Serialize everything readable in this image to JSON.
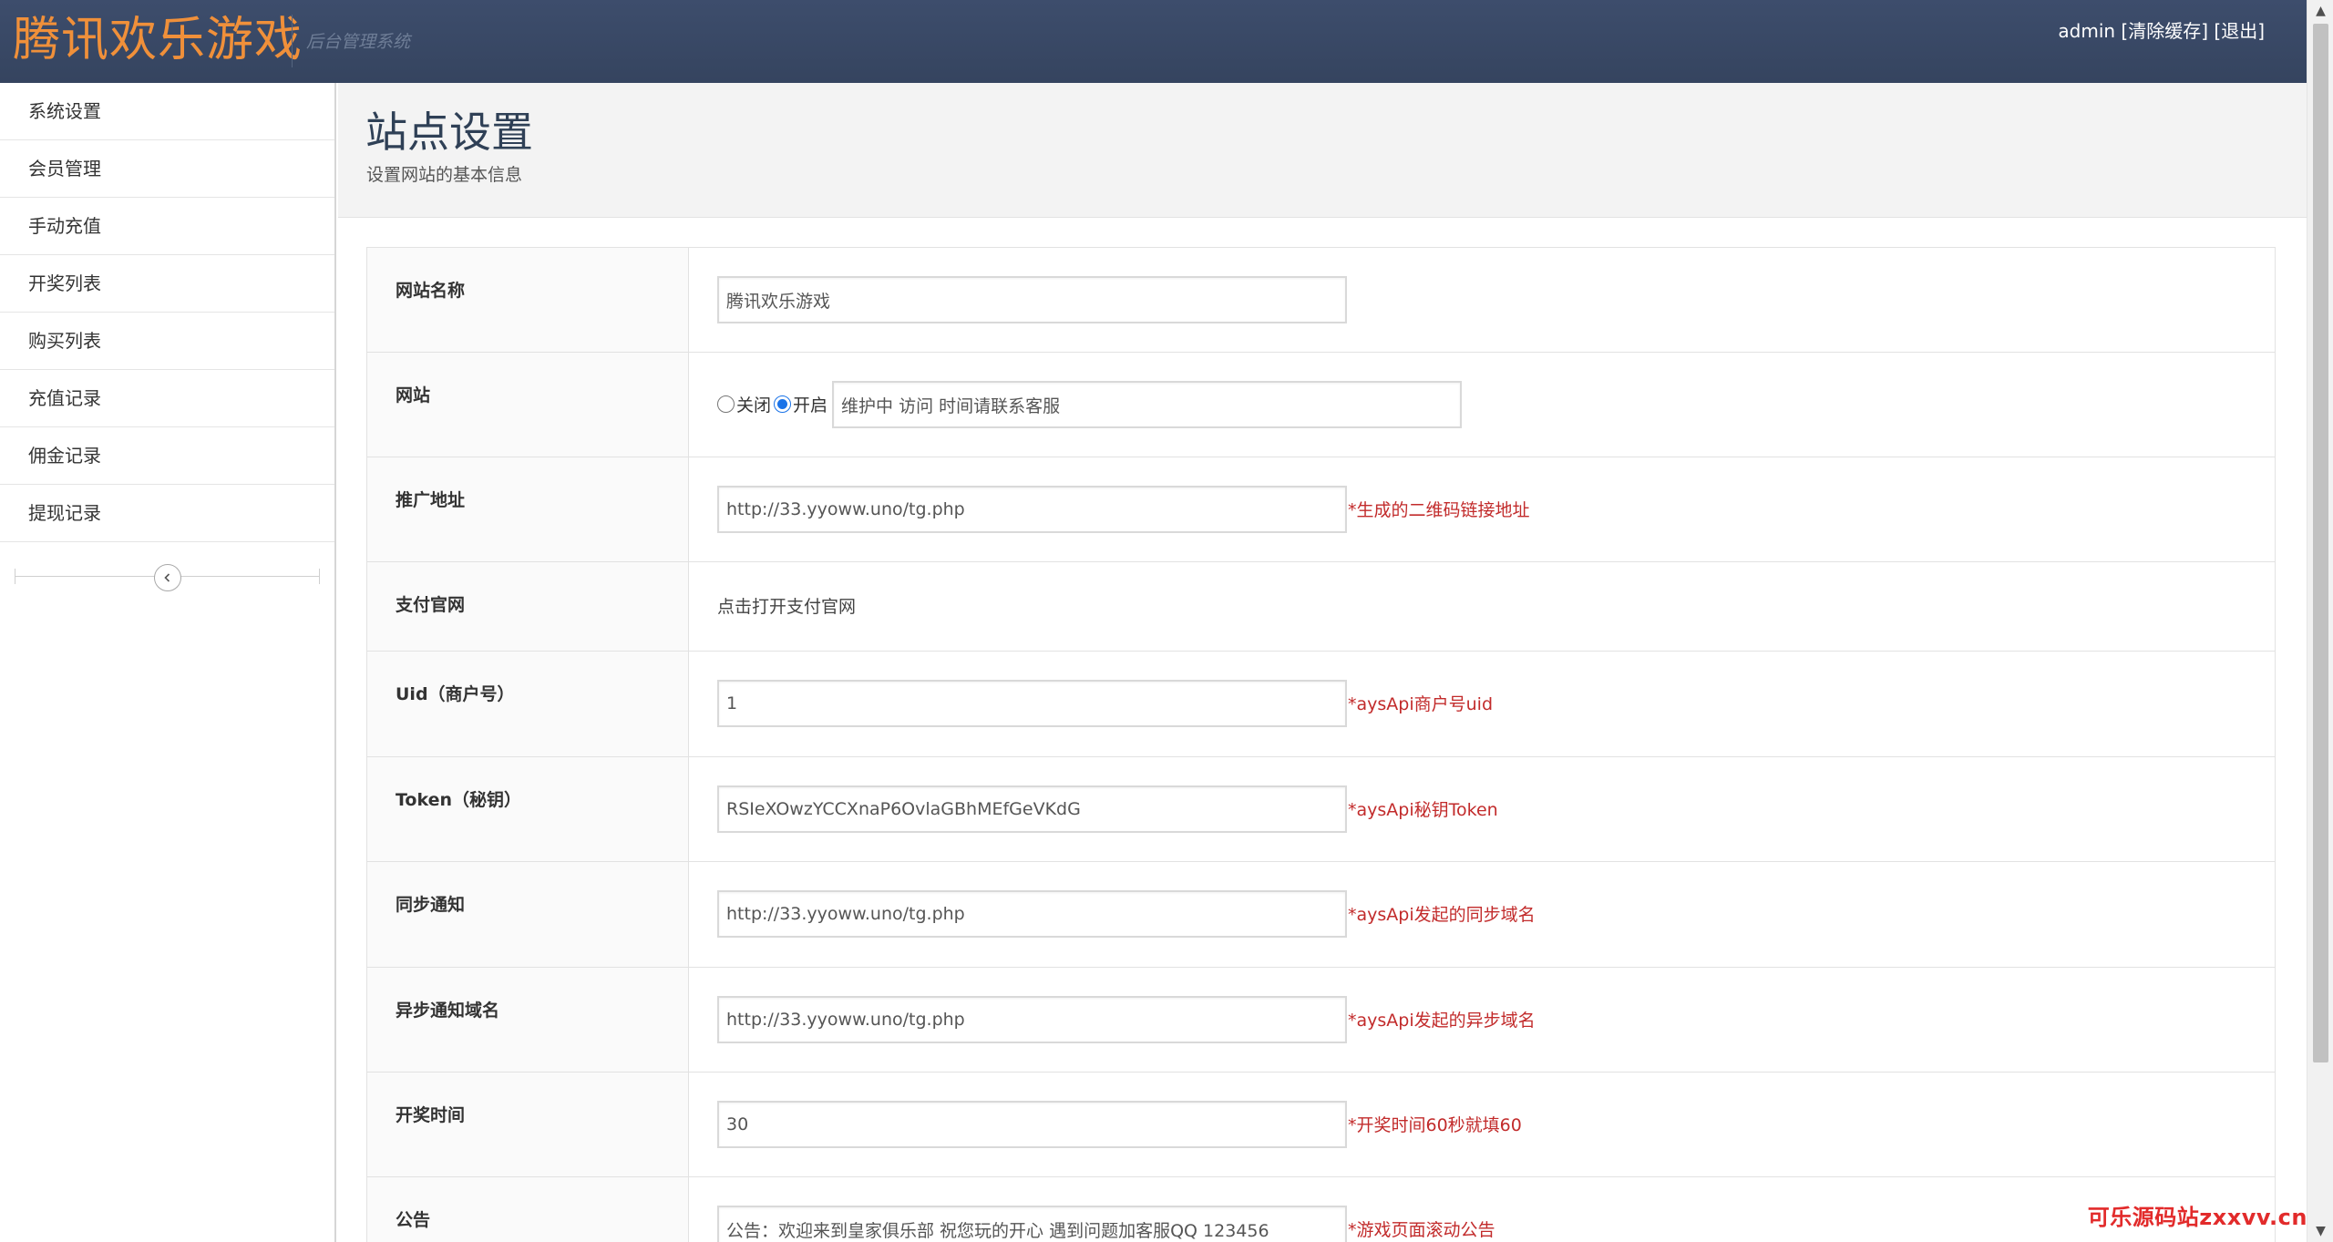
{
  "header": {
    "logo": "腾讯欢乐游戏",
    "subtitle": "后台管理系统",
    "user": "admin",
    "clear_cache": "[清除缓存]",
    "logout": "[退出]"
  },
  "sidebar": {
    "items": [
      {
        "label": "系统设置"
      },
      {
        "label": "会员管理"
      },
      {
        "label": "手动充值"
      },
      {
        "label": "开奖列表"
      },
      {
        "label": "购买列表"
      },
      {
        "label": "充值记录"
      },
      {
        "label": "佣金记录"
      },
      {
        "label": "提现记录"
      }
    ]
  },
  "page": {
    "title": "站点设置",
    "desc": "设置网站的基本信息"
  },
  "form": {
    "site_name": {
      "label": "网站名称",
      "value": "腾讯欢乐游戏"
    },
    "site_status": {
      "label": "网站",
      "off_label": "关闭",
      "on_label": "开启",
      "selected": "开启",
      "message": "维护中 访问 时间请联系客服"
    },
    "promo_url": {
      "label": "推广地址",
      "value": "http://33.yyoww.uno/tg.php",
      "hint": "*生成的二维码链接地址"
    },
    "pay_site": {
      "label": "支付官网",
      "link": "点击打开支付官网"
    },
    "uid": {
      "label": "Uid（商户号）",
      "value": "1",
      "hint": "*aysApi商户号uid"
    },
    "token": {
      "label": "Token（秘钥）",
      "value": "RSIeXOwzYCCXnaP6OvlaGBhMEfGeVKdG",
      "hint": "*aysApi秘钥Token"
    },
    "sync_notify": {
      "label": "同步通知",
      "value": "http://33.yyoww.uno/tg.php",
      "hint": "*aysApi发起的同步域名"
    },
    "async_notify": {
      "label": "异步通知域名",
      "value": "http://33.yyoww.uno/tg.php",
      "hint": "*aysApi发起的异步域名"
    },
    "draw_time": {
      "label": "开奖时间",
      "value": "30",
      "hint": "*开奖时间60秒就填60"
    },
    "notice": {
      "label": "公告",
      "value": "公告：欢迎来到皇家俱乐部 祝您玩的开心 遇到问题加客服QQ 123456",
      "hint": "*游戏页面滚动公告"
    }
  },
  "watermark": "可乐源码站zxxvv.cn",
  "icons": {
    "collapse": "chevron-left-icon",
    "scroll_up": "triangle-up-icon",
    "scroll_down": "triangle-down-icon"
  },
  "colors": {
    "header_bg": "#3a4a68",
    "logo": "#f0903a",
    "hint": "#c22b2b",
    "radio_accent": "#1a73e8",
    "page_title": "#2f4056"
  }
}
